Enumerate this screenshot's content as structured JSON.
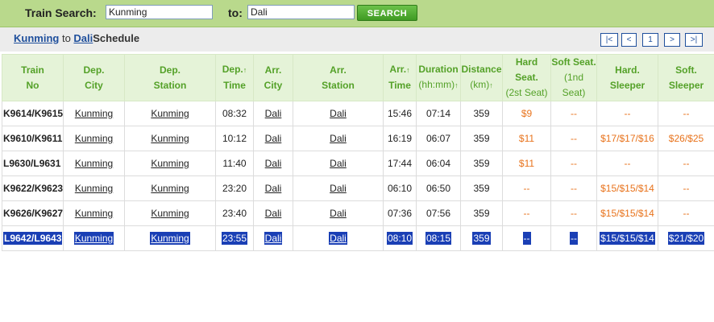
{
  "search": {
    "label_from": "Train Search:",
    "from_value": "Kunming",
    "label_to": "to:",
    "to_value": "Dali",
    "button": "SEARCH"
  },
  "route": {
    "from": "Kunming",
    "connector": "to",
    "to": "Dali",
    "suffix": "Schedule"
  },
  "pager": {
    "first": "|<",
    "prev": "<",
    "page": "1",
    "next": ">",
    "last": ">|"
  },
  "columns": [
    {
      "line1": "Train",
      "line2": "No"
    },
    {
      "line1": "Dep.",
      "line2": "City"
    },
    {
      "line1": "Dep.",
      "line2": "Station"
    },
    {
      "line1": "Dep.",
      "line2": "Time"
    },
    {
      "line1": "Arr.",
      "line2": "City"
    },
    {
      "line1": "Arr.",
      "line2": "Station"
    },
    {
      "line1": "Arr.",
      "line2": "Time"
    },
    {
      "line1": "Duration",
      "line2": "(hh:mm)"
    },
    {
      "line1": "Distance",
      "line2": "(km)"
    },
    {
      "line1": "Hard Seat.",
      "line2": "(2st Seat)"
    },
    {
      "line1": "Soft Seat.",
      "line2": "(1nd Seat)"
    },
    {
      "line1": "Hard.",
      "line2": "Sleeper"
    },
    {
      "line1": "Soft.",
      "line2": "Sleeper"
    }
  ],
  "sort_arrow": "↑",
  "rows": [
    {
      "train": "K9614/K9615",
      "dep_city": "Kunming",
      "dep_station": "Kunming",
      "dep_time": "08:32",
      "arr_city": "Dali",
      "arr_station": "Dali",
      "arr_time": "15:46",
      "duration": "07:14",
      "distance": "359",
      "hard_seat": "$9",
      "soft_seat": "--",
      "hard_sleeper": "--",
      "soft_sleeper": "--"
    },
    {
      "train": "K9610/K9611",
      "dep_city": "Kunming",
      "dep_station": "Kunming",
      "dep_time": "10:12",
      "arr_city": "Dali",
      "arr_station": "Dali",
      "arr_time": "16:19",
      "duration": "06:07",
      "distance": "359",
      "hard_seat": "$11",
      "soft_seat": "--",
      "hard_sleeper": "$17/$17/$16",
      "soft_sleeper": "$26/$25"
    },
    {
      "train": "L9630/L9631",
      "dep_city": "Kunming",
      "dep_station": "Kunming",
      "dep_time": "11:40",
      "arr_city": "Dali",
      "arr_station": "Dali",
      "arr_time": "17:44",
      "duration": "06:04",
      "distance": "359",
      "hard_seat": "$11",
      "soft_seat": "--",
      "hard_sleeper": "--",
      "soft_sleeper": "--"
    },
    {
      "train": "K9622/K9623",
      "dep_city": "Kunming",
      "dep_station": "Kunming",
      "dep_time": "23:20",
      "arr_city": "Dali",
      "arr_station": "Dali",
      "arr_time": "06:10",
      "duration": "06:50",
      "distance": "359",
      "hard_seat": "--",
      "soft_seat": "--",
      "hard_sleeper": "$15/$15/$14",
      "soft_sleeper": "--"
    },
    {
      "train": "K9626/K9627",
      "dep_city": "Kunming",
      "dep_station": "Kunming",
      "dep_time": "23:40",
      "arr_city": "Dali",
      "arr_station": "Dali",
      "arr_time": "07:36",
      "duration": "07:56",
      "distance": "359",
      "hard_seat": "--",
      "soft_seat": "--",
      "hard_sleeper": "$15/$15/$14",
      "soft_sleeper": "--"
    },
    {
      "train": "L9642/L9643",
      "dep_city": "Kunming",
      "dep_station": "Kunming",
      "dep_time": "23:55",
      "arr_city": "Dali",
      "arr_station": "Dali",
      "arr_time": "08:10",
      "duration": "08:15",
      "distance": "359",
      "hard_seat": "--",
      "soft_seat": "--",
      "hard_sleeper": "$15/$15/$14",
      "soft_sleeper": "$21/$20"
    }
  ]
}
